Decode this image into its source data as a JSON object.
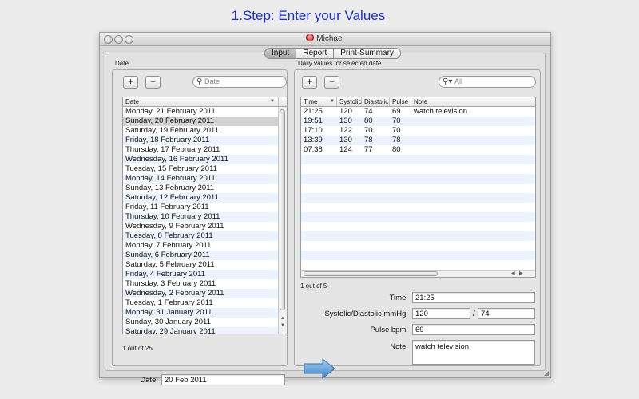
{
  "headline": "1.Step: Enter your Values",
  "window": {
    "title": "Michael"
  },
  "tabs": [
    {
      "label": "Input",
      "selected": true
    },
    {
      "label": "Report",
      "selected": false
    },
    {
      "label": "Print-Summary",
      "selected": false
    }
  ],
  "date_panel": {
    "section_label": "Date",
    "add_label": "+",
    "remove_label": "−",
    "search_placeholder": "Date",
    "column_header": "Date",
    "rows": [
      "Monday, 21 February 2011",
      "Sunday, 20 February 2011",
      "Saturday, 19 February 2011",
      "Friday, 18 February 2011",
      "Thursday, 17 February 2011",
      "Wednesday, 16 February 2011",
      "Tuesday, 15 February 2011",
      "Monday, 14 February 2011",
      "Sunday, 13 February 2011",
      "Saturday, 12 February 2011",
      "Friday, 11 February 2011",
      "Thursday, 10 February 2011",
      "Wednesday, 9 February 2011",
      "Tuesday, 8 February 2011",
      "Monday, 7 February 2011",
      "Sunday, 6 February 2011",
      "Saturday, 5 February 2011",
      "Friday, 4 February 2011",
      "Thursday, 3 February 2011",
      "Wednesday, 2 February 2011",
      "Tuesday, 1 February 2011",
      "Monday, 31 January 2011",
      "Sunday, 30 January 2011",
      "Saturday, 29 January 2011"
    ],
    "selected_row": "Sunday, 20 February 2011",
    "count_text": "1 out of 25",
    "date_field_label": "Date:",
    "date_field_value": "20 Feb 2011"
  },
  "values_panel": {
    "section_label": "Daily values for selected date",
    "add_label": "+",
    "remove_label": "−",
    "search_placeholder": "All",
    "columns": [
      "Time",
      "Systolic",
      "Diastolic",
      "Pulse",
      "Note"
    ],
    "rows": [
      {
        "time": "21:25",
        "systolic": "120",
        "diastolic": "74",
        "pulse": "69",
        "note": "watch television"
      },
      {
        "time": "19:51",
        "systolic": "130",
        "diastolic": "80",
        "pulse": "70",
        "note": ""
      },
      {
        "time": "17:10",
        "systolic": "122",
        "diastolic": "70",
        "pulse": "70",
        "note": ""
      },
      {
        "time": "13:39",
        "systolic": "130",
        "diastolic": "78",
        "pulse": "78",
        "note": ""
      },
      {
        "time": "07:38",
        "systolic": "124",
        "diastolic": "77",
        "pulse": "80",
        "note": ""
      }
    ],
    "count_text": "1 out of 5"
  },
  "form": {
    "time_label": "Time:",
    "time_value": "21:25",
    "bp_label": "Systolic/Diastolic mmHg:",
    "systolic_value": "120",
    "separator": "/",
    "diastolic_value": "74",
    "pulse_label": "Pulse bpm:",
    "pulse_value": "69",
    "note_label": "Note:",
    "note_value": "watch television"
  },
  "colors": {
    "headline": "#1a2fd0",
    "row_alt": "#edf3fe",
    "selected_row": "#d4d4d4",
    "arrow": "#5b9bd5"
  }
}
